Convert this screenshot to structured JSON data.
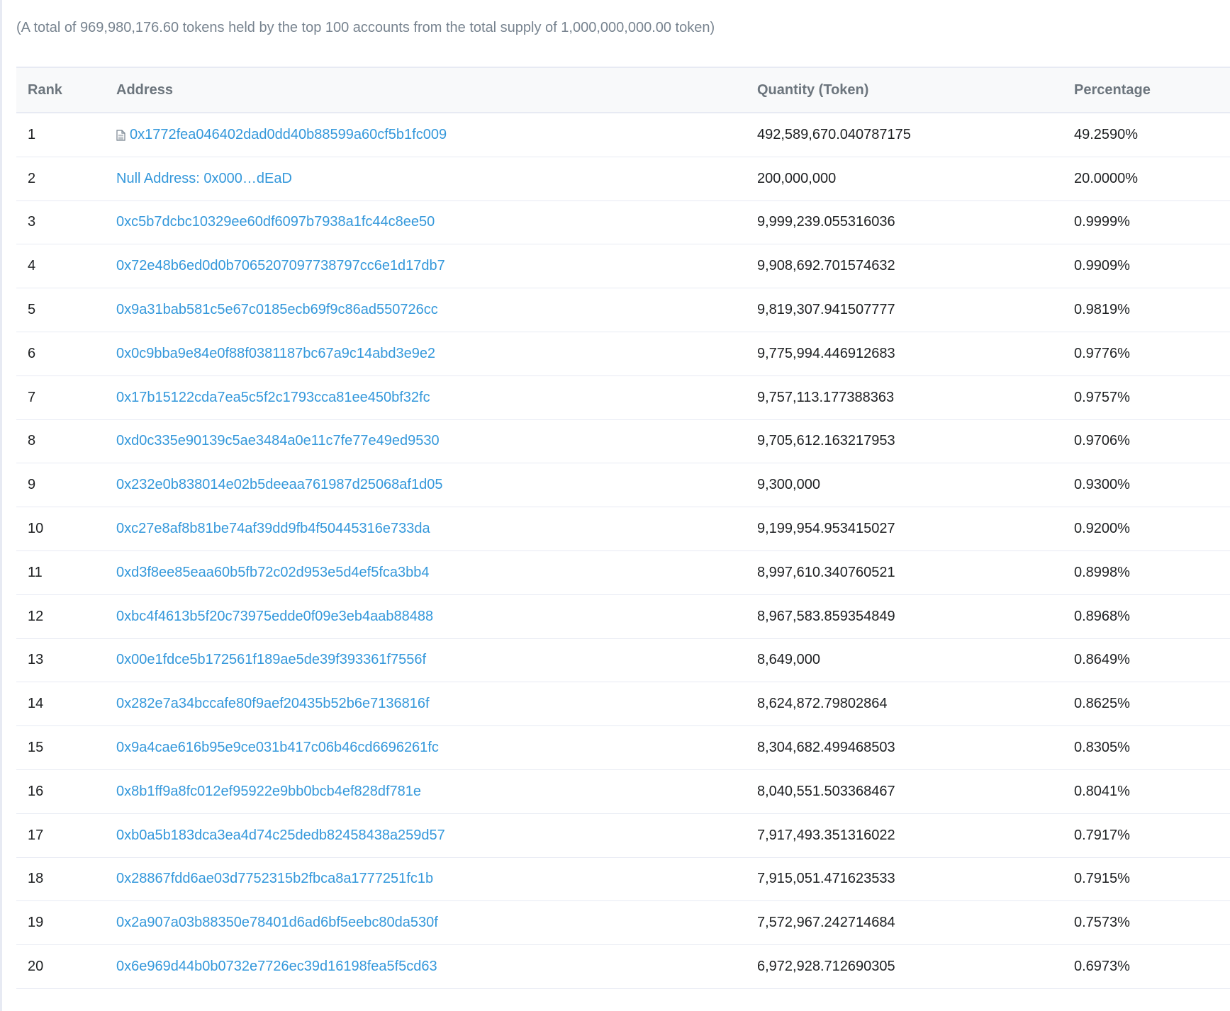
{
  "summary": "(A total of 969,980,176.60 tokens held by the top 100 accounts from the total supply of 1,000,000,000.00 token)",
  "headers": {
    "rank": "Rank",
    "address": "Address",
    "quantity": "Quantity (Token)",
    "percentage": "Percentage"
  },
  "colors": {
    "link": "#3498db",
    "header_bg": "#f8f9fa",
    "border": "#e7eaf3"
  },
  "rows": [
    {
      "rank": "1",
      "address": "0x1772fea046402dad0dd40b88599a60cf5b1fc009",
      "contract": true,
      "icon": "contract-file-icon",
      "quantity": "492,589,670.040787175",
      "percentage": "49.2590%"
    },
    {
      "rank": "2",
      "address": "Null Address: 0x000…dEaD",
      "contract": false,
      "quantity": "200,000,000",
      "percentage": "20.0000%"
    },
    {
      "rank": "3",
      "address": "0xc5b7dcbc10329ee60df6097b7938a1fc44c8ee50",
      "contract": false,
      "quantity": "9,999,239.055316036",
      "percentage": "0.9999%"
    },
    {
      "rank": "4",
      "address": "0x72e48b6ed0d0b7065207097738797cc6e1d17db7",
      "contract": false,
      "quantity": "9,908,692.701574632",
      "percentage": "0.9909%"
    },
    {
      "rank": "5",
      "address": "0x9a31bab581c5e67c0185ecb69f9c86ad550726cc",
      "contract": false,
      "quantity": "9,819,307.941507777",
      "percentage": "0.9819%"
    },
    {
      "rank": "6",
      "address": "0x0c9bba9e84e0f88f0381187bc67a9c14abd3e9e2",
      "contract": false,
      "quantity": "9,775,994.446912683",
      "percentage": "0.9776%"
    },
    {
      "rank": "7",
      "address": "0x17b15122cda7ea5c5f2c1793cca81ee450bf32fc",
      "contract": false,
      "quantity": "9,757,113.177388363",
      "percentage": "0.9757%"
    },
    {
      "rank": "8",
      "address": "0xd0c335e90139c5ae3484a0e11c7fe77e49ed9530",
      "contract": false,
      "quantity": "9,705,612.163217953",
      "percentage": "0.9706%"
    },
    {
      "rank": "9",
      "address": "0x232e0b838014e02b5deeaa761987d25068af1d05",
      "contract": false,
      "quantity": "9,300,000",
      "percentage": "0.9300%"
    },
    {
      "rank": "10",
      "address": "0xc27e8af8b81be74af39dd9fb4f50445316e733da",
      "contract": false,
      "quantity": "9,199,954.953415027",
      "percentage": "0.9200%"
    },
    {
      "rank": "11",
      "address": "0xd3f8ee85eaa60b5fb72c02d953e5d4ef5fca3bb4",
      "contract": false,
      "quantity": "8,997,610.340760521",
      "percentage": "0.8998%"
    },
    {
      "rank": "12",
      "address": "0xbc4f4613b5f20c73975edde0f09e3eb4aab88488",
      "contract": false,
      "quantity": "8,967,583.859354849",
      "percentage": "0.8968%"
    },
    {
      "rank": "13",
      "address": "0x00e1fdce5b172561f189ae5de39f393361f7556f",
      "contract": false,
      "quantity": "8,649,000",
      "percentage": "0.8649%"
    },
    {
      "rank": "14",
      "address": "0x282e7a34bccafe80f9aef20435b52b6e7136816f",
      "contract": false,
      "quantity": "8,624,872.79802864",
      "percentage": "0.8625%"
    },
    {
      "rank": "15",
      "address": "0x9a4cae616b95e9ce031b417c06b46cd6696261fc",
      "contract": false,
      "quantity": "8,304,682.499468503",
      "percentage": "0.8305%"
    },
    {
      "rank": "16",
      "address": "0x8b1ff9a8fc012ef95922e9bb0bcb4ef828df781e",
      "contract": false,
      "quantity": "8,040,551.503368467",
      "percentage": "0.8041%"
    },
    {
      "rank": "17",
      "address": "0xb0a5b183dca3ea4d74c25dedb82458438a259d57",
      "contract": false,
      "quantity": "7,917,493.351316022",
      "percentage": "0.7917%"
    },
    {
      "rank": "18",
      "address": "0x28867fdd6ae03d7752315b2fbca8a1777251fc1b",
      "contract": false,
      "quantity": "7,915,051.471623533",
      "percentage": "0.7915%"
    },
    {
      "rank": "19",
      "address": "0x2a907a03b88350e78401d6ad6bf5eebc80da530f",
      "contract": false,
      "quantity": "7,572,967.242714684",
      "percentage": "0.7573%"
    },
    {
      "rank": "20",
      "address": "0x6e969d44b0b0732e7726ec39d16198fea5f5cd63",
      "contract": false,
      "quantity": "6,972,928.712690305",
      "percentage": "0.6973%"
    }
  ]
}
